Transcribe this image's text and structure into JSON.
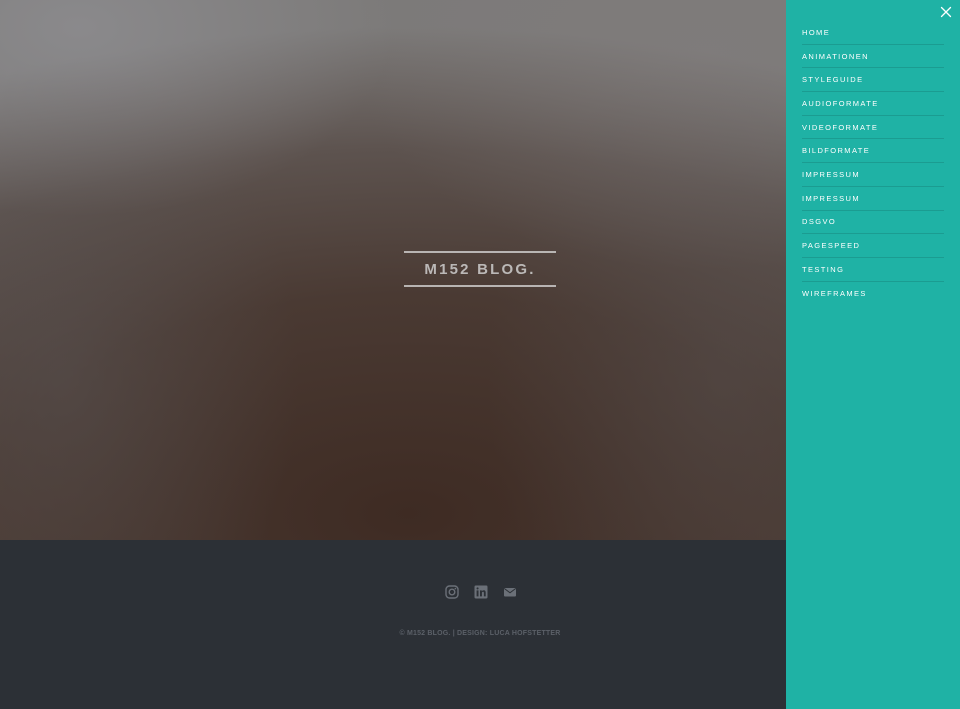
{
  "hero": {
    "title": "M152 BLOG."
  },
  "footer": {
    "social": [
      {
        "icon": "instagram-icon"
      },
      {
        "icon": "linkedin-icon"
      },
      {
        "icon": "envelope-icon"
      }
    ],
    "copyright": "© M152 BLOG. | DESIGN: LUCA HOFSTETTER"
  },
  "sidemenu": {
    "close_icon": "close-icon",
    "items": [
      {
        "label": "HOME"
      },
      {
        "label": "ANIMATIONEN"
      },
      {
        "label": "STYLEGUIDE"
      },
      {
        "label": "AUDIOFORMATE"
      },
      {
        "label": "VIDEOFORMATE"
      },
      {
        "label": "BILDFORMATE"
      },
      {
        "label": "IMPRESSUM"
      },
      {
        "label": "IMPRESSUM"
      },
      {
        "label": "DSGVO"
      },
      {
        "label": "PAGESPEED"
      },
      {
        "label": "TESTING"
      },
      {
        "label": "WIREFRAMES"
      }
    ]
  },
  "colors": {
    "menu_background": "#1fb2a5",
    "footer_background": "#2c3036",
    "footer_text": "#5b6068",
    "icon_color": "#6b7078"
  }
}
